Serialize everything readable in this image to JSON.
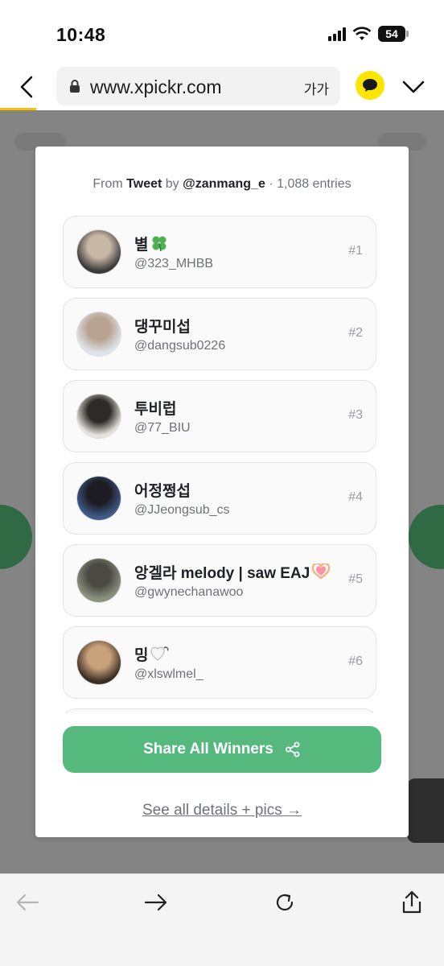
{
  "status_bar": {
    "time": "10:48",
    "battery": "54"
  },
  "browser": {
    "url": "www.xpickr.com",
    "text_size_label": "가가"
  },
  "modal": {
    "source": {
      "prefix": "From",
      "platform": "Tweet",
      "by": "by",
      "author": "@zanmang_e",
      "separator": "·",
      "entries": "1,088 entries"
    },
    "entries": [
      {
        "name": "별",
        "emoji": "clover-icon",
        "handle": "@323_MHBB",
        "rank": "#1",
        "avatar_colors": [
          "#3a3a3a",
          "#c9b8a6"
        ]
      },
      {
        "name": "댕꾸미섭",
        "emoji": "",
        "handle": "@dangsub0226",
        "rank": "#2",
        "avatar_colors": [
          "#dfe3ea",
          "#b8a391"
        ]
      },
      {
        "name": "투비럽",
        "emoji": "",
        "handle": "@77_BIU",
        "rank": "#3",
        "avatar_colors": [
          "#e6e2dc",
          "#2e2a27"
        ]
      },
      {
        "name": "어정쩡섭",
        "emoji": "",
        "handle": "@JJeongsub_cs",
        "rank": "#4",
        "avatar_colors": [
          "#3f5c8a",
          "#1c1c22"
        ]
      },
      {
        "name": "앙겔라 melody | saw EAJ",
        "emoji": "heart-hands-icon",
        "handle": "@gwynechanawoo",
        "rank": "#5",
        "avatar_colors": [
          "#8d927f",
          "#4a4a42"
        ]
      },
      {
        "name": "밍",
        "emoji": "white-heart-icon",
        "handle": "@xlswlmel_",
        "rank": "#6",
        "avatar_colors": [
          "#3b2e24",
          "#c9a27a"
        ]
      }
    ],
    "share_button": "Share All Winners",
    "details_link": "See all details + pics →"
  },
  "colors": {
    "share_green": "#55b97e",
    "kakao_yellow": "#fee500",
    "backdrop_gray": "#848484"
  }
}
